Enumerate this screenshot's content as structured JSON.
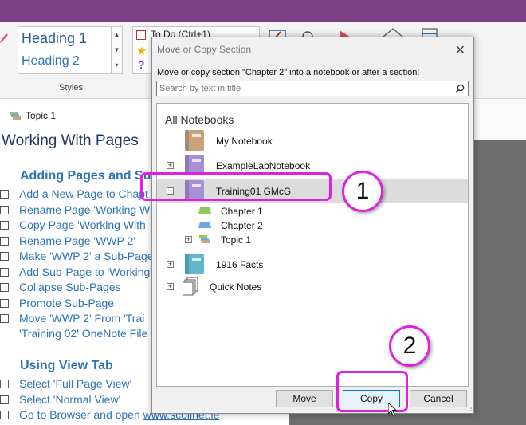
{
  "ribbon": {
    "styles": {
      "heading1": "Heading 1",
      "heading2": "Heading 2",
      "group_label": "Styles"
    },
    "tags": {
      "todo_label": "To Do (Ctrl+1)"
    }
  },
  "page": {
    "topic_tab": "Topic 1",
    "title": "Working With Pages",
    "section1": {
      "heading": "Adding Pages and Su",
      "tasks": [
        "Add a New Page to Chapt",
        "Rename Page 'Working W",
        "Copy Page 'Working With",
        "Rename Page 'WWP 2'",
        "Make 'WWP 2' a Sub-Page",
        "Add Sub-Page to 'Working",
        "Collapse Sub-Pages",
        "Promote Sub-Page",
        "Move 'WWP 2' From 'Trai"
      ],
      "continuation": "'Training 02' OneNote File"
    },
    "section2": {
      "heading": "Using View Tab",
      "tasks": [
        "Select 'Full Page View'",
        "Select 'Normal View'"
      ],
      "last_task_prefix": "Go to Browser and open ",
      "last_task_link": "www.scoilnet.ie"
    }
  },
  "dialog": {
    "title": "Move or Copy Section",
    "close": "✕",
    "instruction": "Move or copy section \"Chapter 2\" into a notebook or after a section:",
    "search_placeholder": "Search by text in title",
    "tree_header": "All Notebooks",
    "notebooks": [
      {
        "label": "My Notebook",
        "color": "#c9a27e",
        "expander": ""
      },
      {
        "label": "ExampleLabNotebook",
        "color": "#a78fd4",
        "expander": "+"
      },
      {
        "label": "Training01 GMcG",
        "color": "#a78fd4",
        "expander": "−"
      }
    ],
    "sections": [
      {
        "label": "Chapter 1",
        "color": "#8fc95a"
      },
      {
        "label": "Chapter 2",
        "color": "#6fa8dc"
      }
    ],
    "section_group": {
      "label": "Topic 1",
      "expander": "+"
    },
    "more_notebooks": [
      {
        "label": "1916 Facts",
        "color": "#5fb7c9",
        "expander": "+"
      },
      {
        "label": "Quick Notes",
        "expander": "+"
      }
    ],
    "buttons": {
      "move": {
        "first": "M",
        "rest": "ove"
      },
      "copy": {
        "first": "C",
        "rest": "opy"
      },
      "cancel": "Cancel"
    }
  },
  "annotations": {
    "step1": "1",
    "step2": "2",
    "highlight_color": "#e020e0"
  }
}
